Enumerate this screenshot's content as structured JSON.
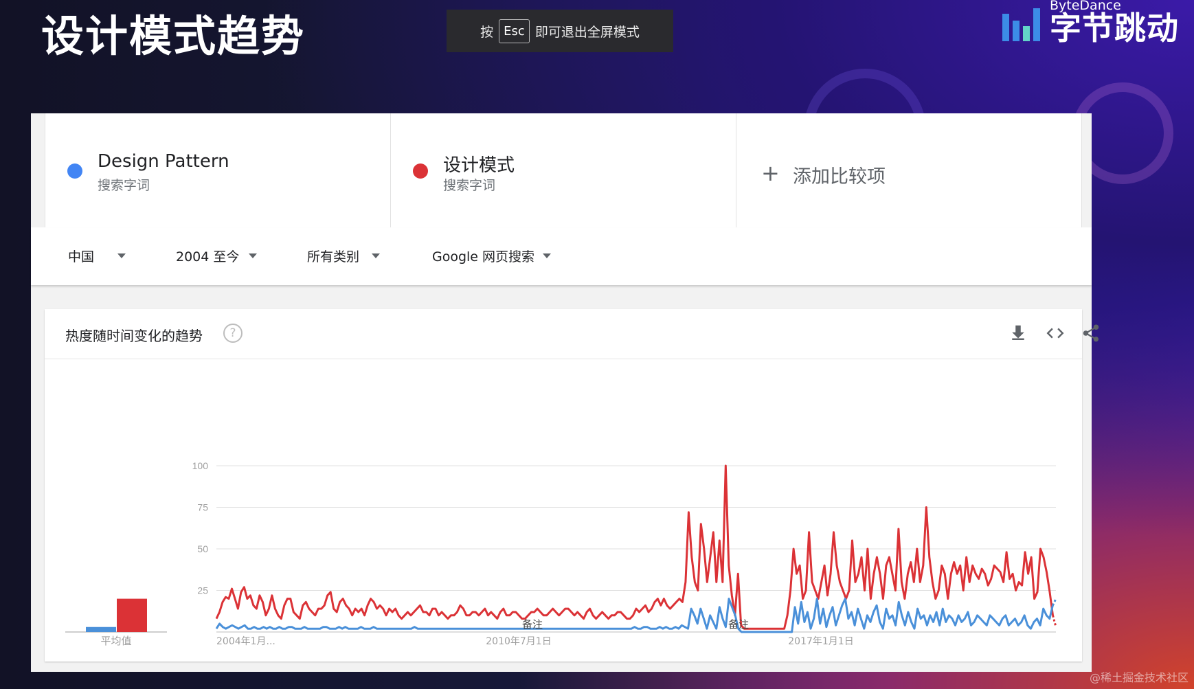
{
  "slide": {
    "title": "设计模式趋势"
  },
  "esc_hint": {
    "prefix": "按",
    "key": "Esc",
    "suffix": "即可退出全屏模式"
  },
  "brand": {
    "en": "ByteDance",
    "cn": "字节跳动"
  },
  "terms": [
    {
      "name": "Design Pattern",
      "sub": "搜索字词",
      "color": "#4285f4"
    },
    {
      "name": "设计模式",
      "sub": "搜索字词",
      "color": "#db3236"
    }
  ],
  "add_compare": {
    "label": "添加比较项"
  },
  "filters": {
    "region": "中国",
    "time": "2004 至今",
    "category": "所有类别",
    "search_type": "Google 网页搜索"
  },
  "card": {
    "title": "热度随时间变化的趋势"
  },
  "watermark": "@稀土掘金技术社区",
  "chart_data": {
    "type": "line",
    "y_ticks": [
      "100",
      "75",
      "50",
      "25"
    ],
    "ylim": [
      0,
      100
    ],
    "x_labels": [
      "2004年1月...",
      "2010年7月1日",
      "2017年1月1日"
    ],
    "avg_label": "平均值",
    "notes": [
      "备注",
      "备注"
    ],
    "average": [
      {
        "name": "Design Pattern",
        "value": 3
      },
      {
        "name": "设计模式",
        "value": 20
      }
    ],
    "series": [
      {
        "name": "设计模式",
        "color": "#db3236",
        "values": [
          8,
          12,
          18,
          21,
          20,
          26,
          20,
          14,
          24,
          27,
          20,
          22,
          16,
          14,
          22,
          18,
          10,
          14,
          22,
          14,
          10,
          8,
          16,
          20,
          20,
          12,
          10,
          8,
          16,
          18,
          14,
          12,
          10,
          14,
          14,
          16,
          22,
          24,
          14,
          12,
          18,
          20,
          16,
          14,
          10,
          14,
          12,
          14,
          10,
          16,
          20,
          18,
          14,
          16,
          14,
          10,
          14,
          12,
          14,
          10,
          8,
          10,
          12,
          10,
          12,
          14,
          16,
          12,
          12,
          10,
          14,
          14,
          10,
          12,
          10,
          8,
          10,
          10,
          12,
          16,
          14,
          10,
          10,
          12,
          12,
          10,
          12,
          14,
          10,
          12,
          10,
          8,
          12,
          14,
          10,
          10,
          12,
          12,
          10,
          8,
          8,
          10,
          12,
          12,
          14,
          12,
          10,
          10,
          12,
          14,
          12,
          10,
          12,
          14,
          14,
          12,
          10,
          12,
          10,
          8,
          12,
          14,
          10,
          8,
          10,
          12,
          10,
          8,
          10,
          10,
          12,
          12,
          10,
          8,
          8,
          10,
          14,
          12,
          14,
          16,
          12,
          14,
          18,
          20,
          16,
          20,
          16,
          14,
          16,
          18,
          20,
          18,
          30,
          72,
          45,
          30,
          25,
          65,
          50,
          30,
          45,
          60,
          30,
          55,
          30,
          100,
          40,
          22,
          10,
          35,
          4,
          2,
          2,
          2,
          2,
          2,
          2,
          2,
          2,
          2,
          2,
          2,
          2,
          2,
          2,
          10,
          25,
          50,
          35,
          40,
          20,
          25,
          60,
          30,
          25,
          20,
          30,
          40,
          22,
          35,
          60,
          40,
          30,
          25,
          20,
          25,
          55,
          30,
          35,
          45,
          25,
          50,
          20,
          35,
          45,
          35,
          20,
          40,
          45,
          35,
          25,
          62,
          30,
          20,
          35,
          42,
          30,
          50,
          30,
          40,
          75,
          45,
          30,
          20,
          25,
          40,
          35,
          20,
          35,
          42,
          35,
          40,
          25,
          45,
          30,
          40,
          35,
          32,
          38,
          35,
          28,
          32,
          40,
          38,
          36,
          30,
          48,
          32,
          35,
          25,
          30,
          28,
          48,
          35,
          45,
          20,
          24,
          50,
          45,
          36,
          24,
          10,
          3
        ],
        "last_dashed": true
      },
      {
        "name": "Design Pattern",
        "color": "#4a90d9",
        "values": [
          2,
          5,
          3,
          2,
          3,
          4,
          3,
          2,
          3,
          4,
          2,
          2,
          3,
          2,
          2,
          3,
          2,
          3,
          2,
          2,
          3,
          2,
          2,
          3,
          3,
          2,
          2,
          2,
          3,
          2,
          2,
          2,
          2,
          2,
          3,
          3,
          2,
          2,
          2,
          3,
          2,
          3,
          2,
          2,
          2,
          2,
          3,
          2,
          2,
          2,
          3,
          2,
          2,
          2,
          2,
          2,
          2,
          2,
          2,
          2,
          2,
          2,
          2,
          3,
          2,
          2,
          2,
          2,
          2,
          2,
          2,
          2,
          2,
          2,
          2,
          2,
          2,
          2,
          2,
          2,
          2,
          2,
          2,
          2,
          2,
          2,
          2,
          2,
          2,
          2,
          2,
          2,
          2,
          2,
          2,
          2,
          2,
          2,
          2,
          2,
          2,
          2,
          2,
          2,
          2,
          2,
          2,
          2,
          2,
          2,
          2,
          2,
          2,
          2,
          2,
          2,
          2,
          2,
          2,
          2,
          2,
          2,
          2,
          2,
          2,
          2,
          2,
          2,
          2,
          2,
          2,
          2,
          2,
          3,
          2,
          2,
          3,
          3,
          2,
          2,
          2,
          3,
          2,
          3,
          2,
          2,
          3,
          2,
          4,
          3,
          2,
          14,
          10,
          5,
          14,
          8,
          2,
          10,
          6,
          2,
          15,
          8,
          3,
          20,
          15,
          10,
          2,
          0,
          0,
          0,
          0,
          0,
          0,
          0,
          0,
          0,
          0,
          0,
          0,
          0,
          0,
          0,
          0,
          0,
          15,
          5,
          18,
          6,
          12,
          2,
          8,
          20,
          5,
          14,
          3,
          10,
          15,
          4,
          10,
          16,
          20,
          8,
          12,
          4,
          14,
          8,
          2,
          10,
          6,
          12,
          16,
          6,
          2,
          14,
          8,
          10,
          4,
          18,
          10,
          4,
          12,
          6,
          2,
          14,
          8,
          10,
          4,
          10,
          6,
          12,
          4,
          14,
          6,
          10,
          8,
          4,
          10,
          6,
          8,
          12,
          4,
          6,
          10,
          8,
          6,
          4,
          10,
          8,
          6,
          4,
          8,
          10,
          4,
          6,
          8,
          4,
          6,
          10,
          4,
          2,
          6,
          8,
          4,
          14,
          10,
          8,
          16,
          20
        ],
        "last_dashed": true
      }
    ]
  }
}
